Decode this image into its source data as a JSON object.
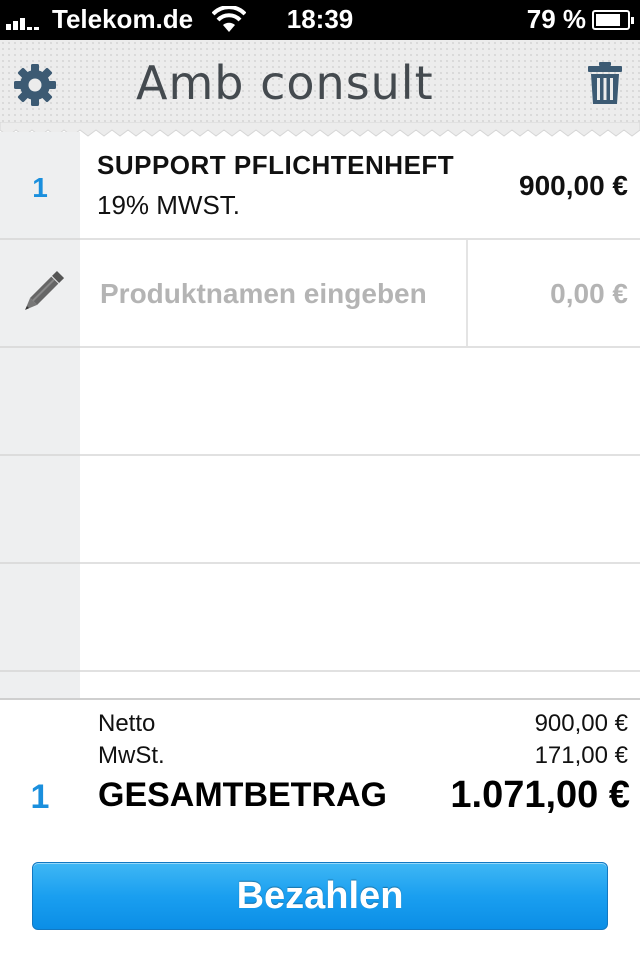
{
  "status_bar": {
    "carrier": "Telekom.de",
    "time": "18:39",
    "battery_percent_text": "79 %",
    "battery_level": 0.79
  },
  "header": {
    "title": "Amb consult",
    "settings_icon": "gear-icon",
    "delete_icon": "trash-icon"
  },
  "items": [
    {
      "qty": "1",
      "name": "SUPPORT PFLICHTENHEFT",
      "tax": "19% MWST.",
      "price": "900,00 €"
    }
  ],
  "new_item": {
    "icon": "pencil-icon",
    "name_placeholder": "Produktnamen eingeben",
    "price_placeholder": "0,00 €"
  },
  "totals": {
    "netto_label": "Netto",
    "netto_value": "900,00 €",
    "mwst_label": "MwSt.",
    "mwst_value": "171,00 €",
    "qty": "1",
    "total_label": "GESAMTBETRAG",
    "total_value": "1.071,00 €"
  },
  "pay_button": {
    "label": "Bezahlen"
  },
  "colors": {
    "accent": "#1a8fdd",
    "button_top": "#3fb7f4",
    "button_bottom": "#0b8ee6",
    "header_bg": "#ececec",
    "gutter_bg": "#eeeff0"
  }
}
